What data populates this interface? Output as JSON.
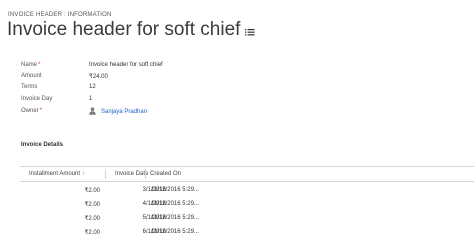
{
  "header": {
    "entity_label": "INVOICE HEADER : INFORMATION",
    "title": "Invoice header for soft chief",
    "menu_icon": "list-menu-icon"
  },
  "form": {
    "name": {
      "label": "Name",
      "value": "Invoice header for soft chief",
      "required": "*"
    },
    "amount": {
      "label": "Amount",
      "value": "₹24.00"
    },
    "terms": {
      "label": "Terms",
      "value": "12"
    },
    "day": {
      "label": "Invoice Day",
      "value": "1"
    },
    "owner": {
      "label": "Owner",
      "value": "Sanjaya Pradhan",
      "required": "*",
      "icon": "user-icon"
    }
  },
  "section": {
    "title": "Invoice Details"
  },
  "grid": {
    "columns": {
      "amount": "Installment Amount",
      "sort_icon": "↑",
      "date": "Invoice Date",
      "created": "Created On"
    },
    "rows": [
      {
        "amount": "₹2.00",
        "date": "3/1/2016",
        "created": "11/12/2016 5:29..."
      },
      {
        "amount": "₹2.00",
        "date": "4/1/2016",
        "created": "11/12/2016 5:29..."
      },
      {
        "amount": "₹2.00",
        "date": "5/1/2016",
        "created": "11/12/2016 5:29..."
      },
      {
        "amount": "₹2.00",
        "date": "6/1/2016",
        "created": "11/12/2016 5:29..."
      }
    ]
  },
  "colors": {
    "link": "#1f62c4",
    "required": "#d13438",
    "border": "#d6d6d6"
  }
}
